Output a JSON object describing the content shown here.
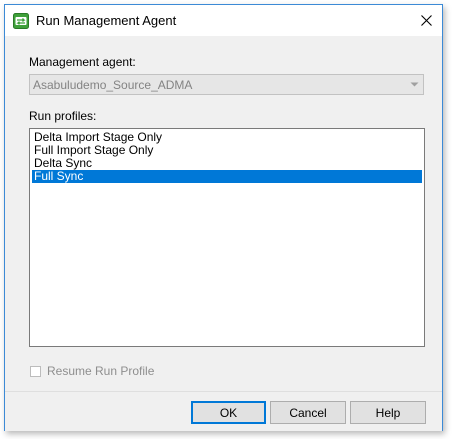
{
  "window": {
    "title": "Run Management Agent",
    "app_icon": "green-refresh-arrows-icon",
    "close_glyph": "×"
  },
  "management_agent": {
    "label": "Management agent:",
    "value": "Asabuludemo_Source_ADMA",
    "enabled": false
  },
  "run_profiles": {
    "label": "Run profiles:",
    "items": [
      {
        "label": "Delta Import Stage Only",
        "selected": false
      },
      {
        "label": "Full Import Stage Only",
        "selected": false
      },
      {
        "label": "Delta Sync",
        "selected": false
      },
      {
        "label": "Full Sync",
        "selected": true
      }
    ]
  },
  "resume_checkbox": {
    "label": "Resume Run Profile",
    "checked": false,
    "enabled": false
  },
  "buttons": {
    "ok_label": "OK",
    "cancel_label": "Cancel",
    "help_label": "Help"
  },
  "colors": {
    "selection": "#0078d7",
    "window_border": "#3c8ad6",
    "dialog_bg": "#f0f0f0",
    "icon_green": "#3fa03a"
  }
}
